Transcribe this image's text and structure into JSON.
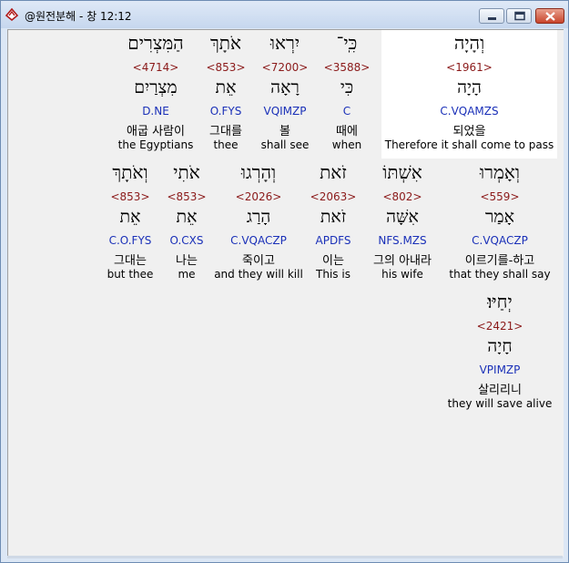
{
  "window": {
    "title": "@원전분해 - 창 12:12",
    "icon": "app-icon"
  },
  "words": [
    {
      "hebrew": "וְהָיָה",
      "strong": "<1961>",
      "lexeme": "הָיָה",
      "morph": "C.VQAMZS",
      "korean": "되었을",
      "english": "Therefore it shall come to pass",
      "selected": true
    },
    {
      "hebrew": "כִּֽי־",
      "strong": "<3588>",
      "lexeme": "כִּי",
      "morph": "C",
      "korean": "때에",
      "english": "when",
      "selected": false
    },
    {
      "hebrew": "יִרְאוּ",
      "strong": "<7200>",
      "lexeme": "רָאָה",
      "morph": "VQIMZP",
      "korean": "볼",
      "english": "shall see",
      "selected": false
    },
    {
      "hebrew": "אֹתָךְ",
      "strong": "<853>",
      "lexeme": "אֵת",
      "morph": "O.FYS",
      "korean": "그대를",
      "english": "thee",
      "selected": false
    },
    {
      "hebrew": "הַמִּצְרִים",
      "strong": "<4714>",
      "lexeme": "מִצְרַיִם",
      "morph": "D.NE",
      "korean": "애굽 사람이",
      "english": "the Egyptians",
      "selected": false
    },
    {
      "hebrew": "וְאָמְרוּ",
      "strong": "<559>",
      "lexeme": "אָמַר",
      "morph": "C.VQACZP",
      "korean": "이르기를-하고",
      "english": "that they shall say",
      "selected": false
    },
    {
      "hebrew": "אִשְׁתּוֹ",
      "strong": "<802>",
      "lexeme": "אִשָּׁה",
      "morph": "NFS.MZS",
      "korean": "그의 아내라",
      "english": "his wife",
      "selected": false
    },
    {
      "hebrew": "זֹאת",
      "strong": "<2063>",
      "lexeme": "זֹאת",
      "morph": "APDFS",
      "korean": "이는",
      "english": "This is",
      "selected": false
    },
    {
      "hebrew": "וְהָרְגוּ",
      "strong": "<2026>",
      "lexeme": "הָרַג",
      "morph": "C.VQACZP",
      "korean": "죽이고",
      "english": "and they will kill",
      "selected": false
    },
    {
      "hebrew": "אֹתִי",
      "strong": "<853>",
      "lexeme": "אֵת",
      "morph": "O.CXS",
      "korean": "나는",
      "english": "me",
      "selected": false
    },
    {
      "hebrew": "וְאֹתָךְ",
      "strong": "<853>",
      "lexeme": "אֵת",
      "morph": "C.O.FYS",
      "korean": "그대는",
      "english": "but thee",
      "selected": false
    },
    {
      "hebrew": "יְחַיּוּ׃",
      "strong": "<2421>",
      "lexeme": "חָיָה",
      "morph": "VPIMZP",
      "korean": "살리리니",
      "english": "they will save alive",
      "selected": false
    }
  ]
}
